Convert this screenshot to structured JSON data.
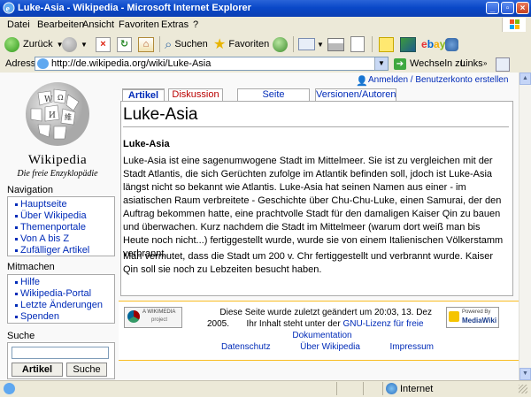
{
  "window": {
    "title": "Luke-Asia - Wikipedia - Microsoft Internet Explorer"
  },
  "menu": [
    "Datei",
    "Bearbeiten",
    "Ansicht",
    "Favoriten",
    "Extras",
    "?"
  ],
  "toolbar": {
    "back_label": "Zurück",
    "search_label": "Suchen",
    "favorites_label": "Favoriten"
  },
  "address": {
    "label": "Adresse",
    "url": "http://de.wikipedia.org/wiki/Luke-Asia",
    "go_label": "Wechseln zu",
    "links_label": "Links"
  },
  "wiki": {
    "logo_title": "Wikipedia",
    "logo_subtitle": "Die freie Enzyklopädie",
    "login_link": "Anmelden / Benutzerkonto erstellen",
    "nav_title": "Navigation",
    "nav_items": [
      "Hauptseite",
      "Über Wikipedia",
      "Themenportale",
      "Von A bis Z",
      "Zufälliger Artikel"
    ],
    "participate_title": "Mitmachen",
    "participate_items": [
      "Hilfe",
      "Wikipedia-Portal",
      "Letzte Änderungen",
      "Spenden"
    ],
    "search_title": "Suche",
    "search_value": "",
    "article_button": "Artikel",
    "search_button": "Suche",
    "tabs": [
      "Artikel",
      "Diskussion",
      "Seite bearbeiten",
      "Versionen/Autoren"
    ],
    "page_title": "Luke-Asia",
    "subheading": "Luke-Asia",
    "paragraph1": "Luke-Asia ist eine sagenumwogene Stadt im Mittelmeer. Sie ist zu vergleichen mit der Stadt Atlantis, die sich Gerüchten zufolge im Atlantik befinden soll, jdoch ist Luke-Asia längst nicht so bekannt wie Atlantis. Luke-Asia hat seinen Namen aus einer - im asiatischen Raum verbreitete - Geschichte über Chu-Chu-Luke, einen Samurai, der den Auftrag bekommen hatte, eine prachtvolle Stadt für den damaligen Kaiser Qin zu bauen und überwachen. Kurz nachdem die Stadt im Mittelmeer (warum dort weiß man bis Heute noch nicht...) fertiggestellt wurde, wurde sie von einem Italienischen Völkerstamm verbrannt.",
    "paragraph2": "Man vermutet, dass die Stadt um 200 v. Chr fertiggestellt und verbrannt wurde. Kaiser Qin soll sie noch zu Lebzeiten besucht haben.",
    "footer": {
      "wikimedia_badge_line1": "A WIKIMEDIA",
      "wikimedia_badge_line2": "project",
      "modified_line1": "Diese Seite wurde zuletzt geändert um 20:03, 13. Dez",
      "modified_line2_prefix": "2005.",
      "license_prefix": "Ihr Inhalt steht unter der",
      "license_link": "GNU-Lizenz für freie",
      "license_link2": "Dokumentation",
      "links": [
        "Datenschutz",
        "Über Wikipedia",
        "Impressum"
      ],
      "mediawiki_line1": "Powered By",
      "mediawiki_line2": "MediaWiki"
    }
  },
  "status": {
    "zone": "Internet"
  },
  "colors": {
    "titlebar": "#0a48c8",
    "link": "#002bb8",
    "visited_tab": "#ba0000",
    "footer_border": "#fabd23"
  }
}
